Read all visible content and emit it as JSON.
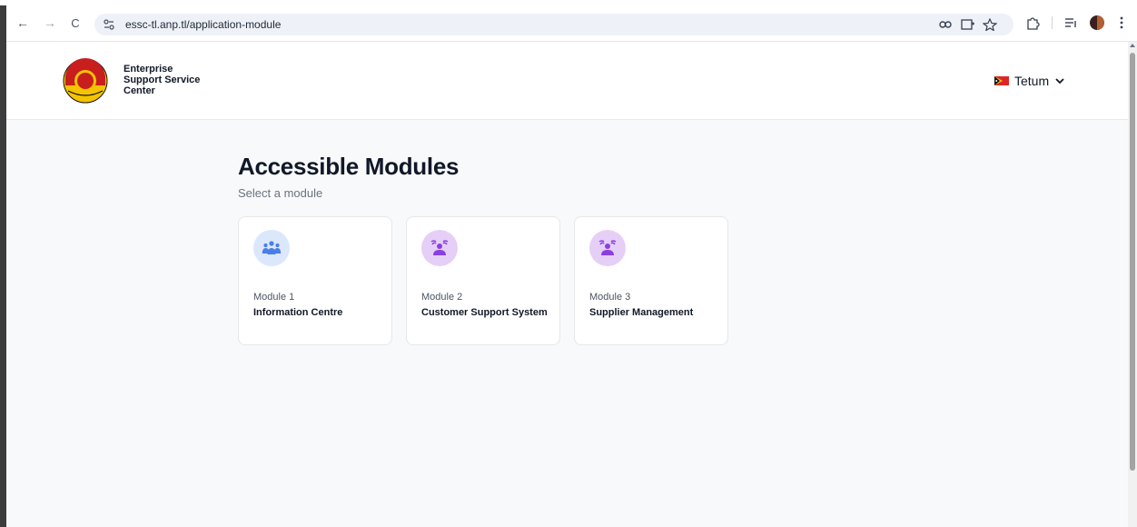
{
  "browser": {
    "url": "essc-tl.anp.tl/application-module",
    "back_icon": "←",
    "forward_icon": "→",
    "reload_icon": "C"
  },
  "header": {
    "brand_line1": "Enterprise",
    "brand_line2": "Support Service",
    "brand_line3": "Center",
    "language": "Tetum"
  },
  "main": {
    "title": "Accessible Modules",
    "subtitle": "Select a module",
    "modules": [
      {
        "number": "Module 1",
        "name": "Information Centre",
        "icon": "users-group-icon",
        "icon_bg": "#dbe7fb",
        "icon_color": "#4a7ee6"
      },
      {
        "number": "Module 2",
        "name": "Customer Support System",
        "icon": "support-agent-icon",
        "icon_bg": "#e6cff7",
        "icon_color": "#8b3fe0"
      },
      {
        "number": "Module 3",
        "name": "Supplier Management",
        "icon": "support-agent-icon",
        "icon_bg": "#e6cff7",
        "icon_color": "#8b3fe0"
      }
    ]
  },
  "colors": {
    "page_bg": "#f8f9fb",
    "logo_yellow": "#f5c400",
    "logo_red": "#c81e1e",
    "flag_red": "#dc2626"
  }
}
